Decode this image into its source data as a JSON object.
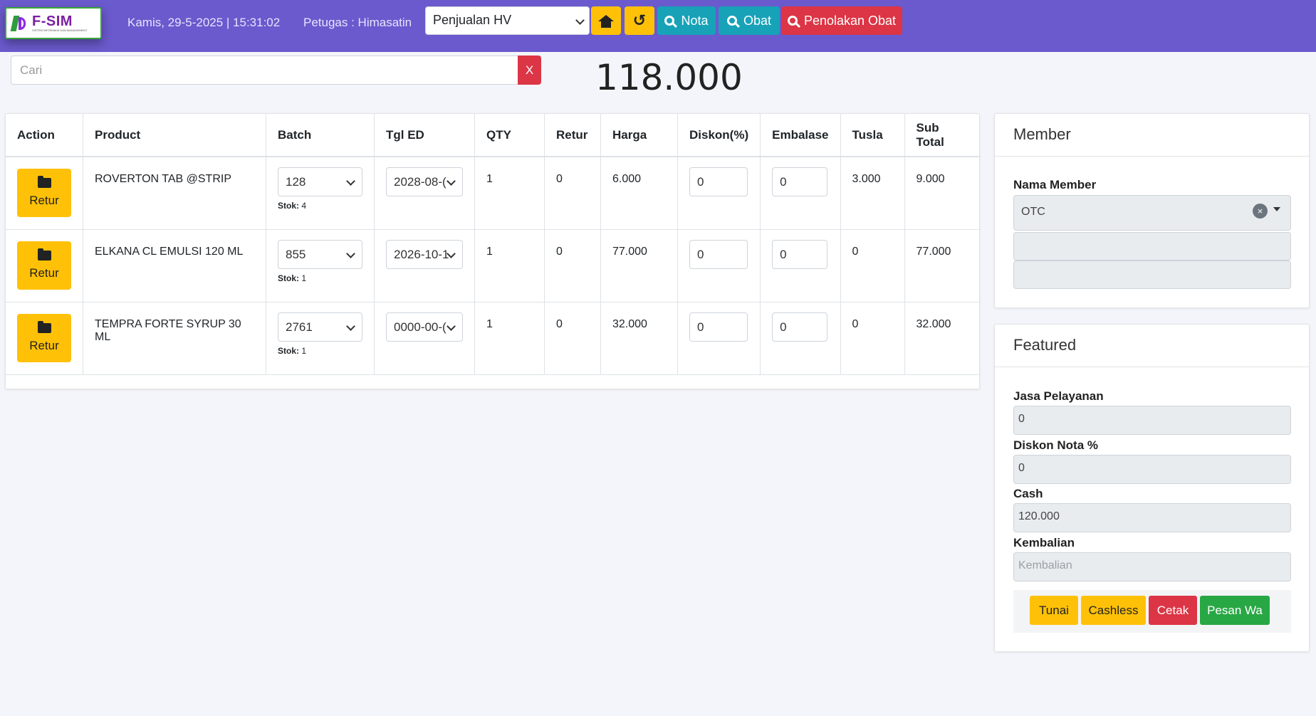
{
  "logo": {
    "main": "F-SIM",
    "sub": "SISTEM INFORMASI DAN MANAGEMENT"
  },
  "header": {
    "datetime": "Kamis, 29-5-2025 | 15:31:02",
    "petugas": "Petugas : Himasatin",
    "mode_select": "Penjualan HV",
    "buttons": {
      "nota": "Nota",
      "obat": "Obat",
      "penolakan": "Penolakan Obat"
    }
  },
  "search": {
    "placeholder": "Cari",
    "clear_label": "X"
  },
  "grand_total": "118.000",
  "table": {
    "columns": [
      "Action",
      "Product",
      "Batch",
      "Tgl ED",
      "QTY",
      "Retur",
      "Harga",
      "Diskon(%)",
      "Embalase",
      "Tusla",
      "Sub Total"
    ],
    "stok_label": "Stok:",
    "action_label": "Retur",
    "rows": [
      {
        "product": "ROVERTON TAB @STRIP",
        "batch": "128",
        "stok": "4",
        "tgl_ed": "2028-08-(",
        "qty": "1",
        "retur": "0",
        "harga": "6.000",
        "diskon": "0",
        "embalase": "0",
        "tusla": "3.000",
        "subtotal": "9.000"
      },
      {
        "product": "ELKANA CL EMULSI 120 ML",
        "batch": "855",
        "stok": "1",
        "tgl_ed": "2026-10-1",
        "qty": "1",
        "retur": "0",
        "harga": "77.000",
        "diskon": "0",
        "embalase": "0",
        "tusla": "0",
        "subtotal": "77.000"
      },
      {
        "product": "TEMPRA FORTE SYRUP 30 ML",
        "batch": "2761",
        "stok": "1",
        "tgl_ed": "0000-00-(",
        "qty": "1",
        "retur": "0",
        "harga": "32.000",
        "diskon": "0",
        "embalase": "0",
        "tusla": "0",
        "subtotal": "32.000"
      }
    ]
  },
  "member": {
    "title": "Member",
    "nama_label": "Nama Member",
    "nama_value": "OTC",
    "clear_icon": "×"
  },
  "featured": {
    "title": "Featured",
    "jasa_label": "Jasa Pelayanan",
    "jasa_value": "0",
    "diskon_label": "Diskon Nota %",
    "diskon_value": "0",
    "cash_label": "Cash",
    "cash_value": "120.000",
    "kembalian_label": "Kembalian",
    "kembalian_placeholder": "Kembalian",
    "buttons": {
      "tunai": "Tunai",
      "cashless": "Cashless",
      "cetak": "Cetak",
      "pesan_wa": "Pesan Wa"
    }
  },
  "colors": {
    "topbar": "#6a5acd",
    "warning": "#ffc107",
    "info": "#17a2b8",
    "danger": "#dc3545",
    "success": "#28a745"
  },
  "icons": {
    "home": "home-icon",
    "refresh": "undo-icon",
    "search": "search-icon",
    "folder": "folder-icon"
  }
}
